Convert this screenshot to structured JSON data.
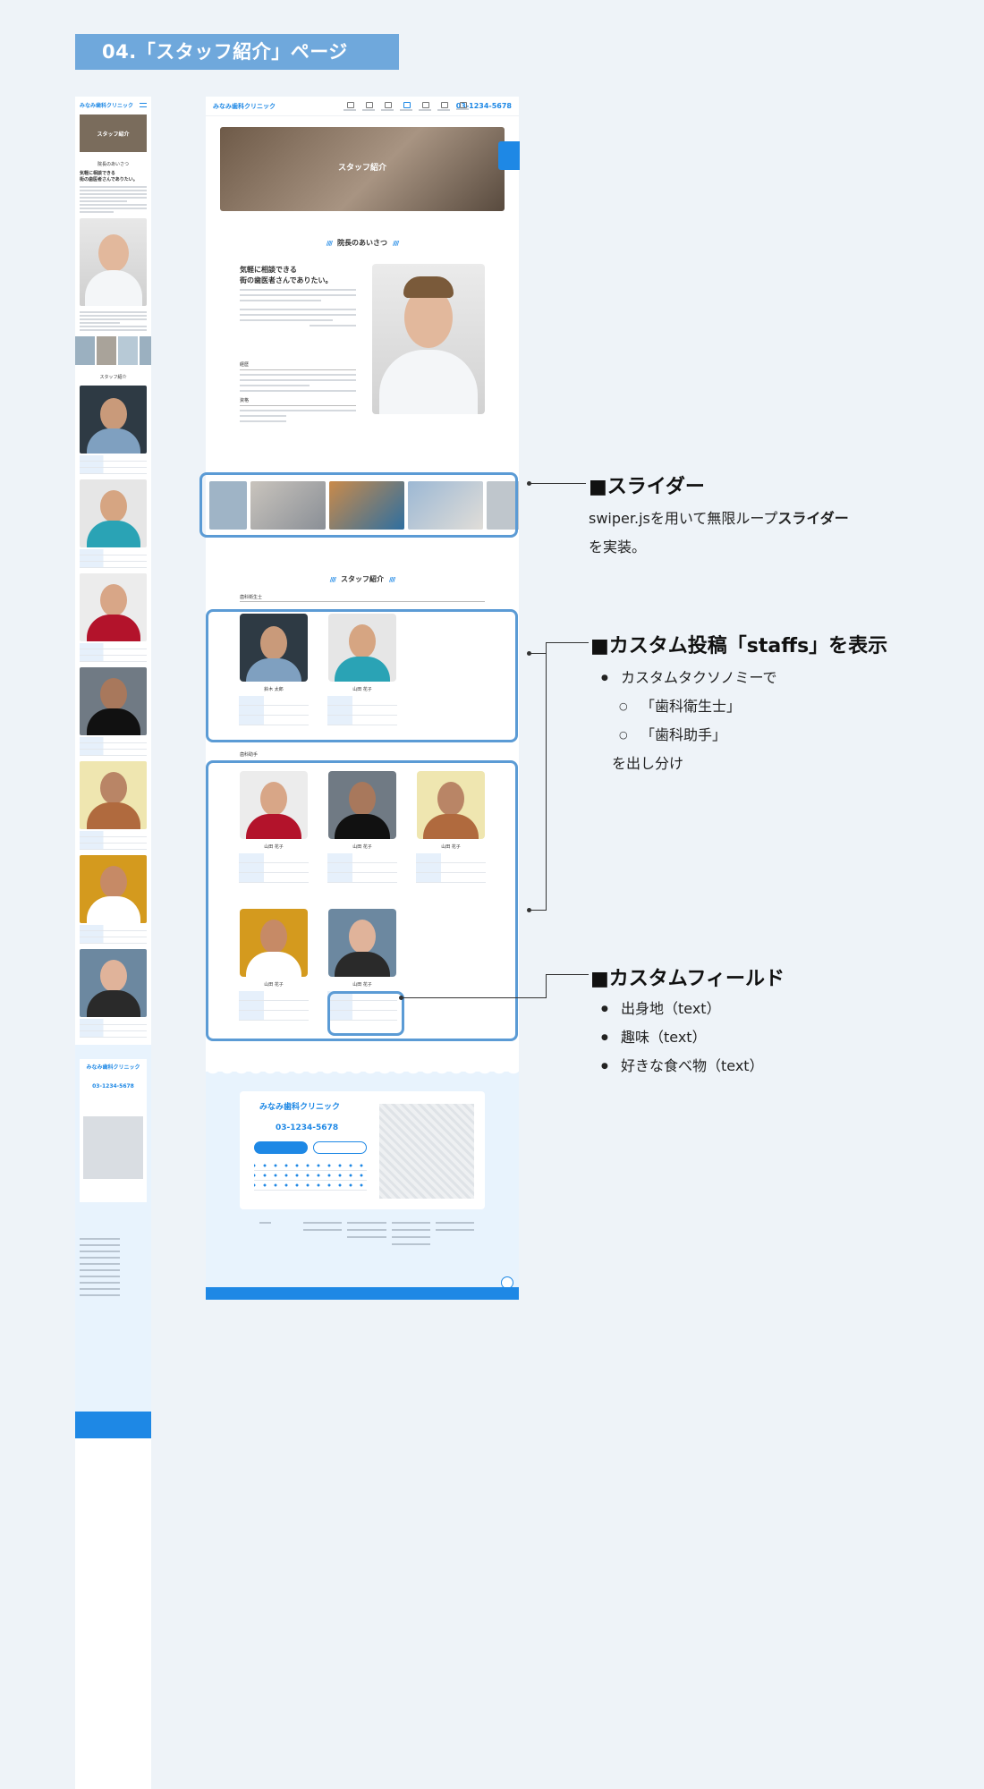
{
  "page": {
    "heading": "04.「スタッフ紹介」ページ"
  },
  "site": {
    "logo": "みなみ歯科クリニック",
    "phone": "03-1234-5678",
    "hero_title": "スタッフ紹介",
    "greeting_title": "院長のあいさつ",
    "greeting_headline_1": "気軽に相談できる",
    "greeting_headline_2": "街の歯医者さんでありたい。",
    "career_label": "経歴",
    "qualification_label": "資格",
    "staff_section_title": "スタッフ紹介",
    "category_hygienist": "歯科衛生士",
    "category_assistant": "歯科助手"
  },
  "staff_cards": [
    {
      "name": "鈴木 太郎",
      "group": "hygienist"
    },
    {
      "name": "山田 花子",
      "group": "hygienist"
    },
    {
      "name": "山田 花子",
      "group": "assistant"
    },
    {
      "name": "山田 花子",
      "group": "assistant"
    },
    {
      "name": "山田 花子",
      "group": "assistant"
    },
    {
      "name": "山田 花子",
      "group": "assistant"
    },
    {
      "name": "山田 花子",
      "group": "assistant"
    }
  ],
  "annotations": {
    "slider": {
      "title": "■スライダー",
      "text_1": "swiper.jsを用いて無限ループ",
      "text_bold": "スライダー",
      "text_2": "を実装。"
    },
    "custom_post": {
      "title": "■カスタム投稿「staffs」を表示",
      "item_1": "カスタムタクソノミーで",
      "sub_1": "「歯科衛生士」",
      "sub_2": "「歯科助手」",
      "tail": "を出し分け"
    },
    "custom_field": {
      "title": "■カスタムフィールド",
      "item_1": "出身地（text）",
      "item_2": "趣味（text）",
      "item_3": "好きな食べ物（text）"
    }
  },
  "colors": {
    "accent": "#1e88e5",
    "highlight_border": "#5b9bd5",
    "heading_bg": "#6fa8dc",
    "background": "#eef3f8"
  }
}
